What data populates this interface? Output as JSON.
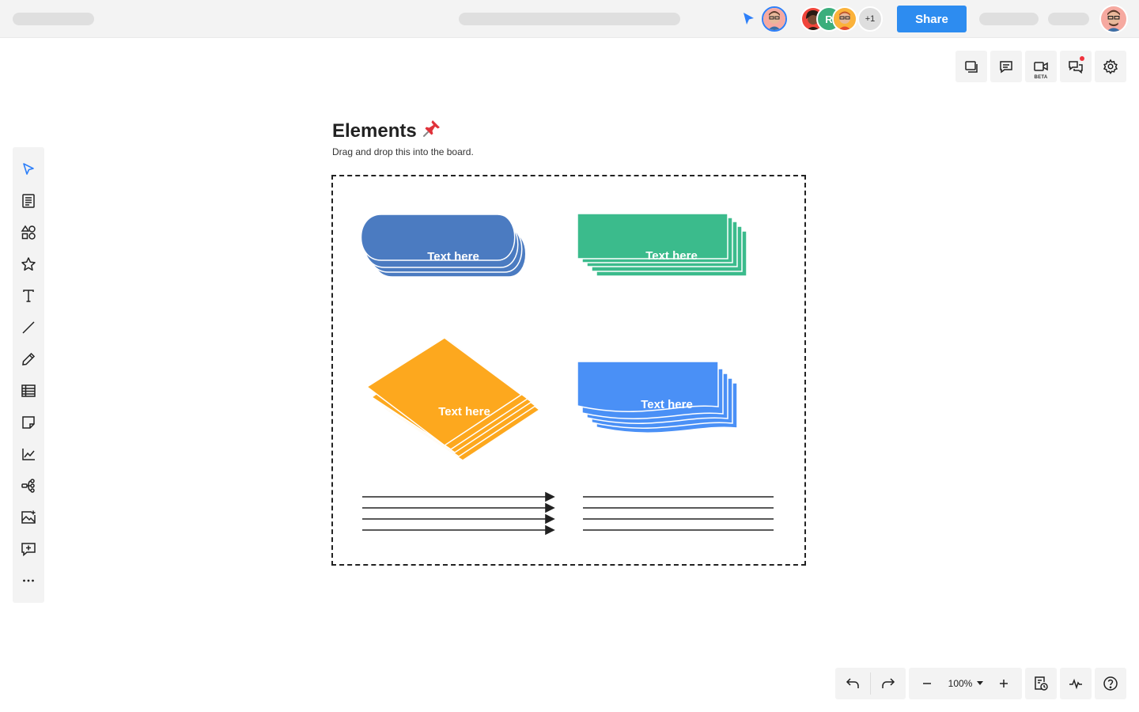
{
  "header": {
    "extra_collaborators": "+1",
    "collaborator_initial": "R",
    "share_label": "Share",
    "colors": {
      "accent": "#2d8cf0",
      "cursor": "#2d7ff9"
    }
  },
  "right_tools": [
    {
      "icon": "layers-icon"
    },
    {
      "icon": "comment-icon"
    },
    {
      "icon": "video-icon",
      "badge": "BETA"
    },
    {
      "icon": "chat-icon"
    },
    {
      "icon": "gear-icon"
    }
  ],
  "left_tools": [
    "select-icon",
    "template-icon",
    "shapes-icon",
    "star-icon",
    "text-icon",
    "line-icon",
    "pen-icon",
    "table-icon",
    "sticky-note-icon",
    "chart-icon",
    "mindmap-icon",
    "image-icon",
    "add-comment-icon",
    "more-icon"
  ],
  "canvas": {
    "title": "Elements",
    "title_emoji": "📌",
    "subtitle": "Drag and drop this into the board.",
    "shapes": [
      {
        "label": "Text here",
        "kind": "stacked-rounded",
        "color": "#4b7bc1"
      },
      {
        "label": "Text here",
        "kind": "stacked-rect",
        "color": "#3bbb8c"
      },
      {
        "label": "Text here",
        "kind": "stacked-diamond",
        "color": "#fda81e"
      },
      {
        "label": "Text here",
        "kind": "stacked-document",
        "color": "#4a90f6"
      }
    ]
  },
  "bottom": {
    "zoom": "100%"
  }
}
